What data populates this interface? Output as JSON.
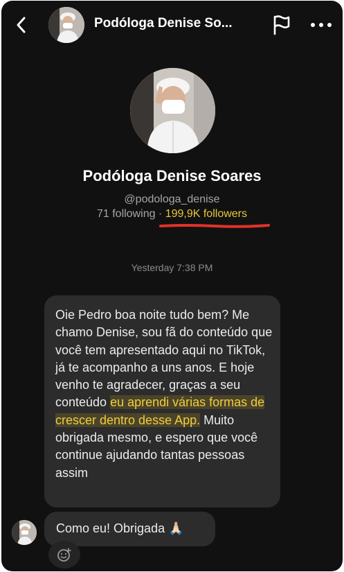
{
  "header": {
    "title": "Podóloga Denise So...",
    "icons": {
      "back": "chevron-left-icon",
      "report": "flag-icon",
      "more": "more-horizontal-icon"
    }
  },
  "profile": {
    "name": "Podóloga Denise Soares",
    "handle": "@podologa_denise",
    "following": "71 following",
    "separator": " · ",
    "followers": "199,9K followers"
  },
  "chat": {
    "timestamp": "Yesterday 7:38 PM",
    "message1": {
      "before": "Oie Pedro boa noite tudo bem? Me chamo Denise, sou fã do conteúdo que você tem apresentado aqui no TikTok, já te acompanho a uns anos. E hoje venho te agradecer, graças a seu conteúdo ",
      "highlight": "eu aprendi várias formas de crescer dentro desse App.",
      "after": " Muito obrigada mesmo, e espero que você continue ajudando tantas pessoas assim"
    },
    "message2": {
      "text": "Como eu! Obrigada",
      "emoji": "🙏🏻"
    }
  },
  "colors": {
    "background": "#111111",
    "bubble": "#2c2c2c",
    "highlight": "#f0cd3c",
    "underline": "#e0322b"
  }
}
